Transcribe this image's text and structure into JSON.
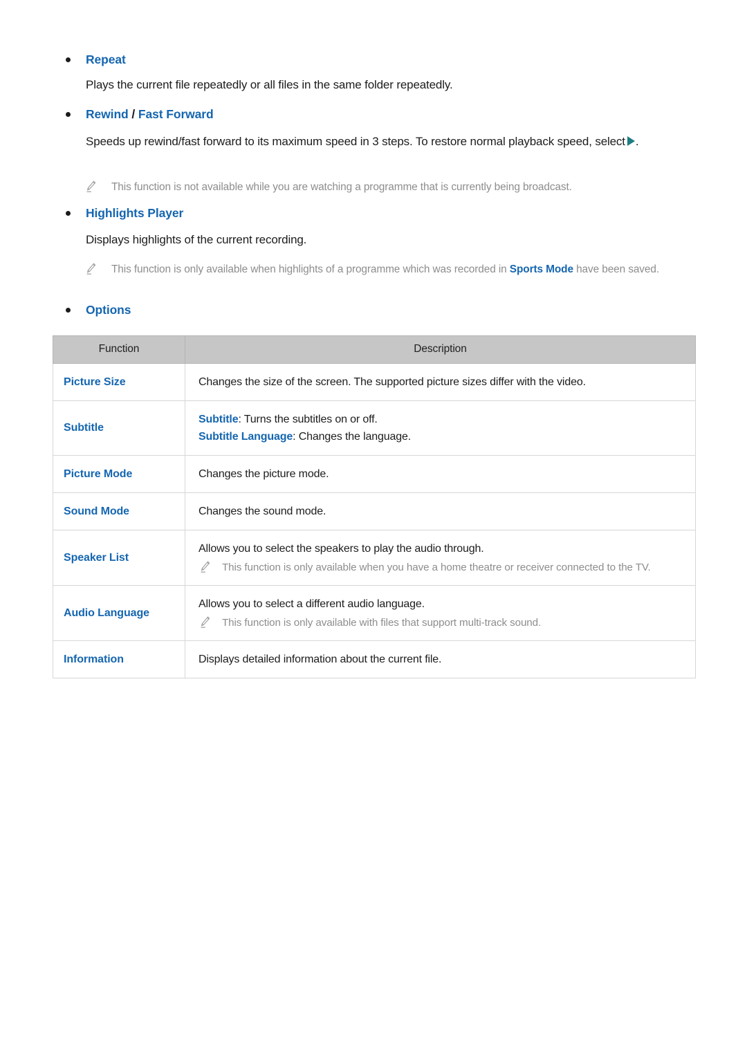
{
  "document": {
    "sections": [
      {
        "heading": "Repeat",
        "heading_parts": [
          {
            "text": "Repeat",
            "style": "link"
          }
        ],
        "body": "Plays the current file repeatedly or all files in the same folder repeatedly.",
        "notes": []
      },
      {
        "heading": "Rewind / Fast Forward",
        "heading_parts": [
          {
            "text": "Rewind",
            "style": "link"
          },
          {
            "text": " / ",
            "style": "plain"
          },
          {
            "text": "Fast Forward",
            "style": "link"
          }
        ],
        "body_before_glyph": "Speeds up rewind/fast forward to its maximum speed in 3 steps. To restore normal playback speed, select",
        "body_glyph": "play-triangle",
        "body_after_glyph": ".",
        "notes": [
          {
            "text": "This function is not available while you are watching a programme that is currently being broadcast."
          }
        ]
      },
      {
        "heading": "Highlights Player",
        "heading_parts": [
          {
            "text": "Highlights Player",
            "style": "link"
          }
        ],
        "body": "Displays highlights of the current recording.",
        "notes": [
          {
            "prefix": "This function is only available when highlights of a programme which was recorded in ",
            "accent": "Sports Mode",
            "suffix": " have been saved."
          }
        ]
      },
      {
        "heading": "Options",
        "heading_parts": [
          {
            "text": "Options",
            "style": "link"
          }
        ]
      }
    ],
    "table": {
      "columns": [
        "Function",
        "Description"
      ],
      "rows": [
        {
          "function": "Picture Size",
          "description": "Changes the size of the screen. The supported picture sizes differ with the video.",
          "lines": [
            {
              "type": "plain",
              "text": "Changes the size of the screen. The supported picture sizes differ with the video."
            }
          ]
        },
        {
          "function": "Subtitle",
          "description": "Subtitle: Turns the subtitles on or off. Subtitle Language: Changes the language.",
          "lines": [
            {
              "type": "kw-line",
              "keyword": "Subtitle",
              "rest": ": Turns the subtitles on or off."
            },
            {
              "type": "kw-line",
              "keyword": "Subtitle Language",
              "rest": ": Changes the language."
            }
          ]
        },
        {
          "function": "Picture Mode",
          "description": "Changes the picture mode.",
          "lines": [
            {
              "type": "plain",
              "text": "Changes the picture mode."
            }
          ]
        },
        {
          "function": "Sound Mode",
          "description": "Changes the sound mode.",
          "lines": [
            {
              "type": "plain",
              "text": "Changes the sound mode."
            }
          ]
        },
        {
          "function": "Speaker List",
          "description": "Allows you to select the speakers to play the audio through.",
          "lines": [
            {
              "type": "plain",
              "text": "Allows you to select the speakers to play the audio through."
            },
            {
              "type": "note",
              "text": "This function is only available when you have a home theatre or receiver connected to the TV."
            }
          ]
        },
        {
          "function": "Audio Language",
          "description": "Allows you to select a different audio language.",
          "lines": [
            {
              "type": "plain",
              "text": "Allows you to select a different audio language."
            },
            {
              "type": "note",
              "text": "This function is only available with files that support multi-track sound."
            }
          ]
        },
        {
          "function": "Information",
          "description": "Displays detailed information about the current file.",
          "lines": [
            {
              "type": "plain",
              "text": "Displays detailed information about the current file."
            }
          ]
        }
      ]
    },
    "colors": {
      "link_blue": "#1566b0",
      "note_gray": "#8d8d8d",
      "body_black": "#1c1c1c",
      "table_header_bg": "#c6c6c6",
      "table_border": "#d6d6d6",
      "play_glyph_teal": "#1d7d82"
    }
  }
}
